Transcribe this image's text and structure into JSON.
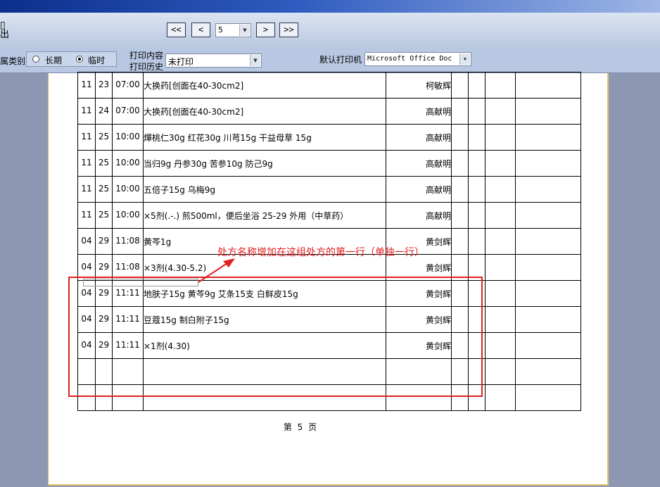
{
  "toolbar": {
    "exit_label": "出",
    "first_btn": "<<",
    "prev_btn": "<",
    "page_value": "5",
    "next_btn": ">",
    "last_btn": ">>"
  },
  "filter": {
    "category_label": "属类别",
    "option_long": "长期",
    "option_temp": "临时",
    "selected": "临时",
    "print_content_label": "打印内容",
    "print_history_label": "打印历史",
    "print_value": "未打印",
    "default_printer_label": "默认打印机",
    "printer_value": "Microsoft Office Doc"
  },
  "rows": [
    {
      "month": "11",
      "day": "23",
      "time": "07:00",
      "content": "大换药[创面在40-30cm2]",
      "doctor": "柯敏辉"
    },
    {
      "month": "11",
      "day": "24",
      "time": "07:00",
      "content": "大换药[创面在40-30cm2]",
      "doctor": "高献明"
    },
    {
      "month": "11",
      "day": "25",
      "time": "10:00",
      "content": "燀桃仁30g 红花30g 川芎15g 干益母草 15g",
      "doctor": "高献明"
    },
    {
      "month": "11",
      "day": "25",
      "time": "10:00",
      "content": "当归9g 丹参30g 苦参10g 防己9g",
      "doctor": "高献明"
    },
    {
      "month": "11",
      "day": "25",
      "time": "10:00",
      "content": "五倍子15g 乌梅9g",
      "doctor": "高献明"
    },
    {
      "month": "11",
      "day": "25",
      "time": "10:00",
      "content": "×5剂(.-.)  煎500ml，便后坐浴 25-29 外用（中草药）",
      "doctor": "高献明"
    },
    {
      "month": "04",
      "day": "29",
      "time": "11:08",
      "content": "黄芩1g",
      "doctor": "黄剑辉"
    },
    {
      "month": "04",
      "day": "29",
      "time": "11:08",
      "content": "×3剂(4.30-5.2)",
      "doctor": "黄剑辉"
    },
    {
      "month": "04",
      "day": "29",
      "time": "11:11",
      "content": "地肤子15g 黄芩9g 艾条15支 白鲜皮15g",
      "doctor": "黄剑辉"
    },
    {
      "month": "04",
      "day": "29",
      "time": "11:11",
      "content": "豆蔻15g 制白附子15g",
      "doctor": "黄剑辉"
    },
    {
      "month": "04",
      "day": "29",
      "time": "11:11",
      "content": "×1剂(4.30)",
      "doctor": "黄剑辉"
    },
    {
      "month": "",
      "day": "",
      "time": "",
      "content": "",
      "doctor": ""
    },
    {
      "month": "",
      "day": "",
      "time": "",
      "content": "",
      "doctor": ""
    }
  ],
  "footer": {
    "prefix": "第",
    "page": "5",
    "suffix": "页"
  },
  "annotation": {
    "text": "处方名称增加在这组处方的第一行（单独一行）",
    "color": "#e02020"
  }
}
